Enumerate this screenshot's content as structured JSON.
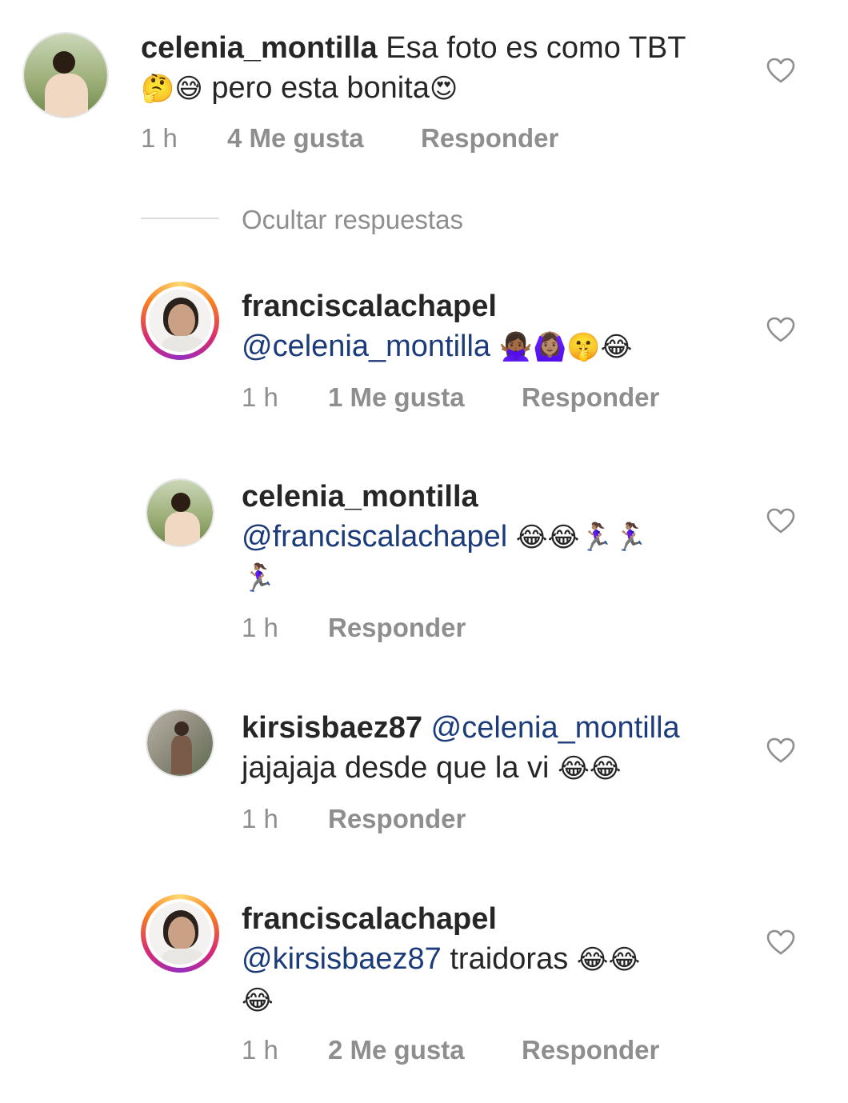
{
  "comments": [
    {
      "user": "celenia_montilla",
      "line1": "Esa foto es como TBT",
      "line2_emoji": "🤔😅",
      "line2_text": "pero esta bonita",
      "line2_tail": "😍",
      "time": "1 h",
      "likes": "4 Me gusta",
      "reply": "Responder"
    },
    {
      "user": "franciscalachapel",
      "mention": "@celenia_montilla",
      "emoji": "🙅🏾‍♀️🙆🏽‍♀️🤫😂",
      "time": "1 h",
      "likes": "1 Me gusta",
      "reply": "Responder"
    },
    {
      "user": "celenia_montilla",
      "mention": "@franciscalachapel",
      "emoji": "😂😂🏃🏽‍♀️🏃🏽‍♀️",
      "emoji2": "🏃🏽‍♀️",
      "time": "1 h",
      "reply": "Responder"
    },
    {
      "user": "kirsisbaez87",
      "mention": "@celenia_montilla",
      "text": "jajajaja desde que la vi",
      "emoji": "😂😂",
      "time": "1 h",
      "reply": "Responder"
    },
    {
      "user": "franciscalachapel",
      "mention": "@kirsisbaez87",
      "text": "traidoras",
      "emoji": "😂😂",
      "emoji2": "😂",
      "time": "1 h",
      "likes": "2 Me gusta",
      "reply": "Responder"
    }
  ],
  "hide_replies": "Ocultar respuestas",
  "icons": {
    "like": "heart-outline-icon"
  },
  "colors": {
    "mention": "#1b3b7a",
    "muted": "#8e8e8e"
  }
}
